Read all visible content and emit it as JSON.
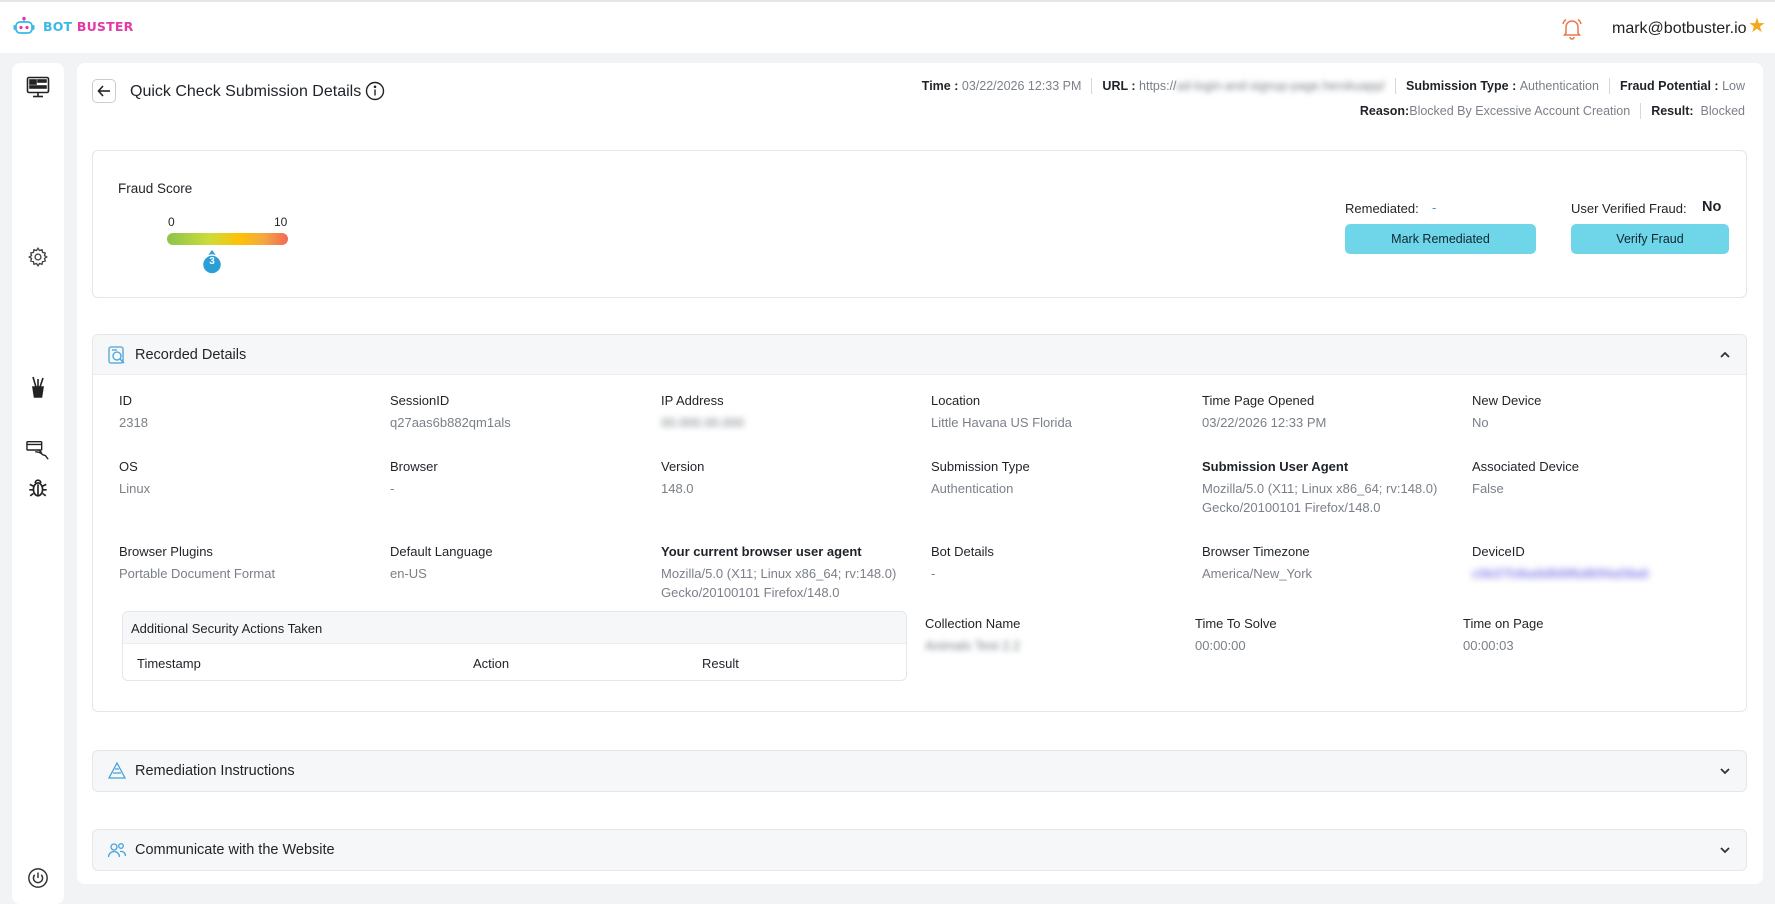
{
  "header": {
    "brand_part1": "BOT",
    "brand_part2": "BUSTER",
    "user_email": "mark@botbuster.io"
  },
  "sidebar": {
    "items": [
      "dashboard-icon",
      "settings-icon",
      "tools-icon",
      "card-hand-icon",
      "bug-icon",
      "power-icon"
    ]
  },
  "page": {
    "title": "Quick Check Submission Details",
    "meta": {
      "time_label": "Time :",
      "time_value": "03/22/2026 12:33 PM",
      "url_label": "URL :",
      "url_value": "https://",
      "url_hidden": "ad-login-and-signup-page.herokuapp/",
      "submission_type_label": "Submission Type :",
      "submission_type_value": "Authentication",
      "fraud_potential_label": "Fraud Potential :",
      "fraud_potential_value": "Low",
      "reason_label": "Reason:",
      "reason_value": "Blocked By Excessive Account Creation",
      "result_label": "Result:",
      "result_value": "Blocked"
    }
  },
  "fraud_score": {
    "label": "Fraud Score",
    "min": "0",
    "max": "10",
    "value": "3",
    "value_fraction": 0.3,
    "remediated_label": "Remediated:",
    "remediated_value": "-",
    "user_verified_label": "User Verified Fraud:",
    "user_verified_value": "No",
    "mark_remediated_button": "Mark Remediated",
    "verify_fraud_button": "Verify Fraud"
  },
  "recorded_details": {
    "title": "Recorded Details",
    "id": {
      "label": "ID",
      "value": "2318"
    },
    "session_id": {
      "label": "SessionID",
      "value": "q27aas6b882qm1als"
    },
    "ip_address": {
      "label": "IP Address",
      "value": "00.000.00.000"
    },
    "location": {
      "label": "Location",
      "value": "Little Havana US Florida"
    },
    "time_page_opened": {
      "label": "Time Page Opened",
      "value": "03/22/2026 12:33 PM"
    },
    "new_device": {
      "label": "New Device",
      "value": "No"
    },
    "os": {
      "label": "OS",
      "value": "Linux"
    },
    "browser": {
      "label": "Browser",
      "value": "-"
    },
    "version": {
      "label": "Version",
      "value": "148.0"
    },
    "submission_type": {
      "label": "Submission Type",
      "value": "Authentication"
    },
    "submission_user_agent": {
      "label": "Submission User Agent",
      "value_line1": "Mozilla/5.0 (X11; Linux x86_64; rv:148.0)",
      "value_line2": "Gecko/20100101 Firefox/148.0"
    },
    "associated_device": {
      "label": "Associated Device",
      "value": "False"
    },
    "browser_plugins": {
      "label": "Browser Plugins",
      "value": "Portable Document Format"
    },
    "default_language": {
      "label": "Default Language",
      "value": "en-US"
    },
    "current_user_agent": {
      "label": "Your current browser user agent",
      "value_line1": "Mozilla/5.0 (X11; Linux x86_64; rv:148.0)",
      "value_line2": "Gecko/20100101 Firefox/148.0"
    },
    "bot_details": {
      "label": "Bot Details",
      "value": "-"
    },
    "browser_timezone": {
      "label": "Browser Timezone",
      "value": "America/New_York"
    },
    "device_id": {
      "label": "DeviceID",
      "value": "c0b3754ba9dfd9f6d80f4a58a9"
    },
    "collection_name": {
      "label": "Collection Name",
      "value": "Animals Test 2.2"
    },
    "time_to_solve": {
      "label": "Time To Solve",
      "value": "00:00:00"
    },
    "time_on_page": {
      "label": "Time on Page",
      "value": "00:00:03"
    },
    "security_actions": {
      "title": "Additional Security Actions Taken",
      "columns": [
        "Timestamp",
        "Action",
        "Result"
      ]
    }
  },
  "accordions": {
    "remediation": "Remediation Instructions",
    "communicate": "Communicate with the Website"
  }
}
